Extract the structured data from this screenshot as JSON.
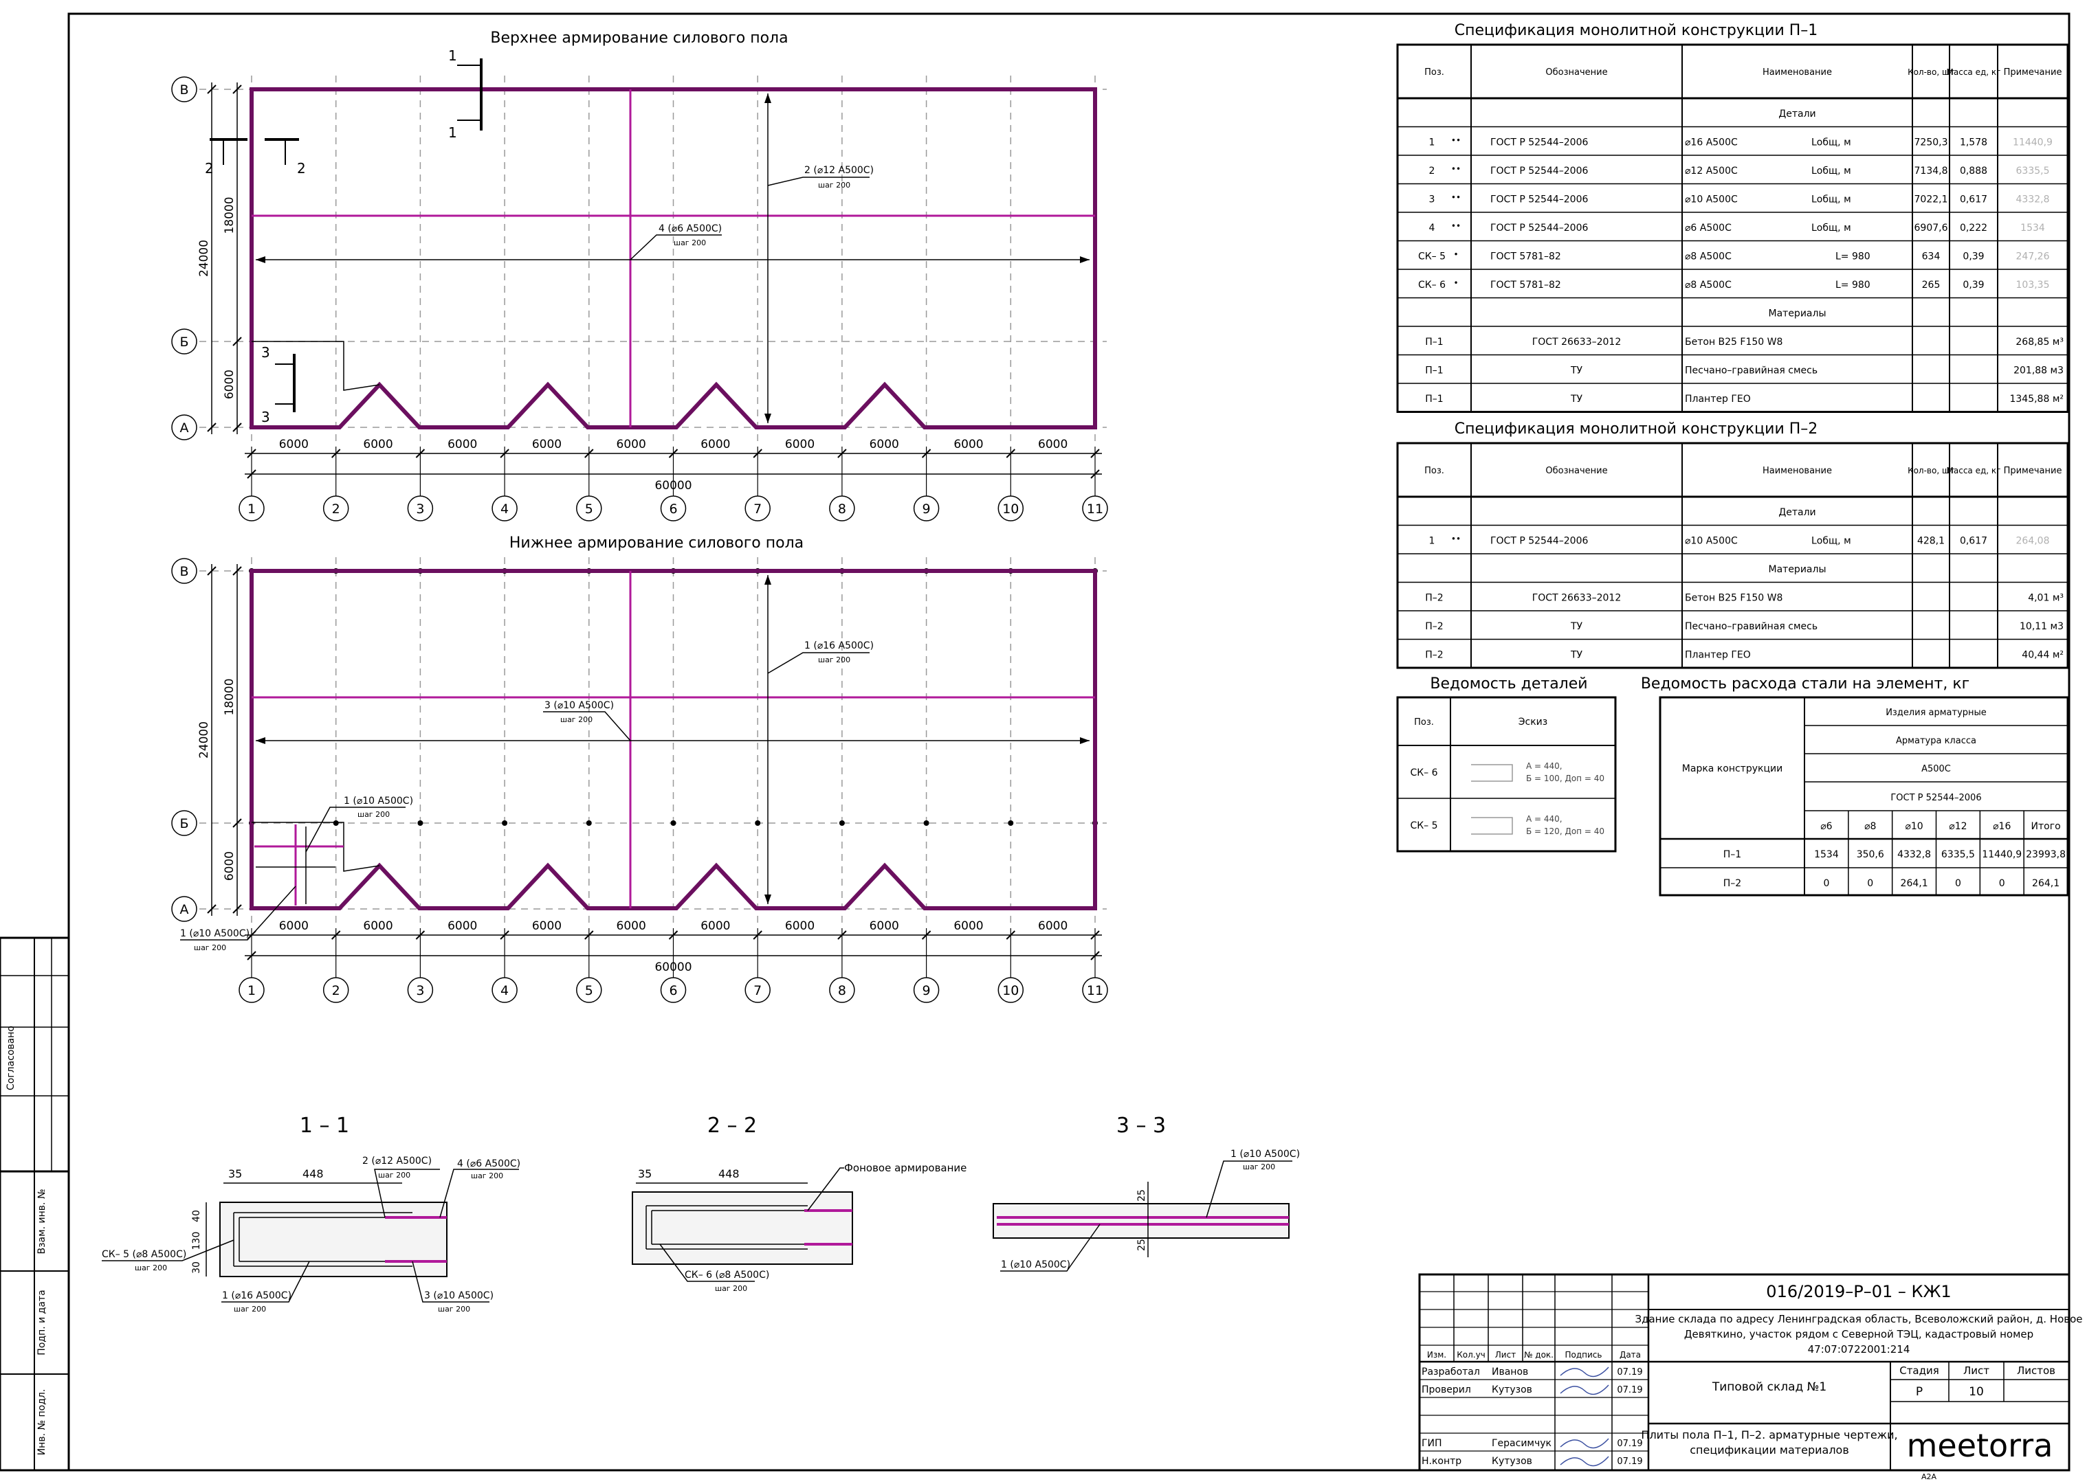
{
  "plan_top": {
    "title": "Верхнее армирование силового пола",
    "rows": [
      "В",
      "Б",
      "А"
    ],
    "cols": [
      "1",
      "2",
      "3",
      "4",
      "5",
      "6",
      "7",
      "8",
      "9",
      "10",
      "11"
    ],
    "spans": [
      "6000",
      "6000",
      "6000",
      "6000",
      "6000",
      "6000",
      "6000",
      "6000",
      "6000",
      "6000"
    ],
    "total": "60000",
    "dim_total_v": "24000",
    "dim_top_v": "18000",
    "dim_bottom_v": "6000",
    "callout_a": "2 (⌀12 А500С)",
    "callout_a_step": "шаг 200",
    "callout_b": "4 (⌀6 А500С)",
    "callout_b_step": "шаг 200",
    "cut_1": "1",
    "cut_2": "2",
    "cut_3": "3"
  },
  "plan_bottom": {
    "title": "Нижнее армирование силового пола",
    "rows": [
      "В",
      "Б",
      "А"
    ],
    "cols": [
      "1",
      "2",
      "3",
      "4",
      "5",
      "6",
      "7",
      "8",
      "9",
      "10",
      "11"
    ],
    "spans": [
      "6000",
      "6000",
      "6000",
      "6000",
      "6000",
      "6000",
      "6000",
      "6000",
      "6000",
      "6000"
    ],
    "total": "60000",
    "dim_total_v": "24000",
    "dim_top_v": "18000",
    "dim_bottom_v": "6000",
    "callout_a": "1 (⌀16 А500С)",
    "callout_a_step": "шаг 200",
    "callout_b": "3 (⌀10 А500С)",
    "callout_b_step": "шаг 200",
    "callout_c": "1 (⌀10 А500С)",
    "callout_c_step": "шаг 200",
    "callout_d": "1 (⌀10 А500С)",
    "callout_d_step": "шаг 200"
  },
  "sections": {
    "s1": {
      "title": "1 – 1",
      "dim_35": "35",
      "dim_448": "448",
      "dim_40": "40",
      "dim_130": "130",
      "dim_30": "30",
      "l1": "2 (⌀12 А500С)",
      "l1s": "шаг 200",
      "l2": "4 (⌀6 А500С)",
      "l2s": "шаг 200",
      "l3": "СК– 5 (⌀8 А500С)",
      "l3s": "шаг 200",
      "l4": "1 (⌀16 А500С)",
      "l4s": "шаг 200",
      "l5": "3 (⌀10 А500С)",
      "l5s": "шаг 200"
    },
    "s2": {
      "title": "2 – 2",
      "dim_35": "35",
      "dim_448": "448",
      "l1": "Фоновое армирование",
      "l2": "СК– 6 (⌀8 А500С)",
      "l2s": "шаг 200"
    },
    "s3": {
      "title": "3 – 3",
      "dim_25a": "25",
      "dim_25b": "25",
      "l1": "1 (⌀10 А500С)",
      "l1s": "шаг 200",
      "l2": "1 (⌀10 А500С)"
    }
  },
  "spec1": {
    "title": "Спецификация монолитной конструкции П–1",
    "headers": [
      "Поз.",
      "Обозначение",
      "Наименование",
      "Кол-во, шт",
      "Масса ед, кг",
      "Примечание"
    ],
    "group_details": "Детали",
    "group_materials": "Материалы",
    "details": [
      {
        "pos": "1",
        "mark": "••",
        "doc": "ГОСТ Р 52544–2006",
        "name": "⌀16 А500С",
        "extra": "Lобщ, м",
        "qty": "7250,3",
        "mass": "1,578",
        "note": "11440,9"
      },
      {
        "pos": "2",
        "mark": "••",
        "doc": "ГОСТ Р 52544–2006",
        "name": "⌀12 А500С",
        "extra": "Lобщ, м",
        "qty": "7134,8",
        "mass": "0,888",
        "note": "6335,5"
      },
      {
        "pos": "3",
        "mark": "••",
        "doc": "ГОСТ Р 52544–2006",
        "name": "⌀10 А500С",
        "extra": "Lобщ, м",
        "qty": "7022,1",
        "mass": "0,617",
        "note": "4332,8"
      },
      {
        "pos": "4",
        "mark": "••",
        "doc": "ГОСТ Р 52544–2006",
        "name": "⌀6 А500С",
        "extra": "Lобщ, м",
        "qty": "6907,6",
        "mass": "0,222",
        "note": "1534"
      },
      {
        "pos": "СК– 5",
        "mark": "•",
        "doc": "ГОСТ 5781–82",
        "name": "⌀8 А500С",
        "extra": "L= 980",
        "qty": "634",
        "mass": "0,39",
        "note": "247,26"
      },
      {
        "pos": "СК– 6",
        "mark": "•",
        "doc": "ГОСТ 5781–82",
        "name": "⌀8 А500С",
        "extra": "L= 980",
        "qty": "265",
        "mass": "0,39",
        "note": "103,35"
      }
    ],
    "materials": [
      {
        "pos": "П–1",
        "doc": "ГОСТ 26633–2012",
        "name": "Бетон B25 F150 W8",
        "note": "268,85 м³"
      },
      {
        "pos": "П–1",
        "doc": "ТУ",
        "name": "Песчано–гравийная смесь",
        "note": "201,88 м3"
      },
      {
        "pos": "П–1",
        "doc": "ТУ",
        "name": "Плантер ГЕО",
        "note": "1345,88 м²"
      }
    ]
  },
  "spec2": {
    "title": "Спецификация монолитной конструкции П–2",
    "headers": [
      "Поз.",
      "Обозначение",
      "Наименование",
      "Кол-во, шт",
      "Масса ед, кг",
      "Примечание"
    ],
    "group_details": "Детали",
    "group_materials": "Материалы",
    "details": [
      {
        "pos": "1",
        "mark": "••",
        "doc": "ГОСТ Р 52544–2006",
        "name": "⌀10 А500С",
        "extra": "Lобщ, м",
        "qty": "428,1",
        "mass": "0,617",
        "note": "264,08"
      }
    ],
    "materials": [
      {
        "pos": "П–2",
        "doc": "ГОСТ 26633–2012",
        "name": "Бетон B25 F150 W8",
        "note": "4,01 м³"
      },
      {
        "pos": "П–2",
        "doc": "ТУ",
        "name": "Песчано–гравийная смесь",
        "note": "10,11 м3"
      },
      {
        "pos": "П–2",
        "doc": "ТУ",
        "name": "Плантер ГЕО",
        "note": "40,44 м²"
      }
    ]
  },
  "parts": {
    "title": "Ведомость деталей",
    "headers": [
      "Поз.",
      "Эскиз"
    ],
    "rows": [
      {
        "pos": "СК– 6",
        "line1": "А = 440,",
        "line2": "Б = 100, Доп = 40"
      },
      {
        "pos": "СК– 5",
        "line1": "А = 440,",
        "line2": "Б = 120, Доп = 40"
      }
    ]
  },
  "steel": {
    "title": "Ведомость расхода стали на элемент, кг",
    "h_mark": "Марка конструкции",
    "h_items": "Изделия арматурные",
    "h_class": "Арматура класса",
    "h_a500": "А500С",
    "h_gost": "ГОСТ Р 52544–2006",
    "cols": [
      "⌀6",
      "⌀8",
      "⌀10",
      "⌀12",
      "⌀16",
      "Итого"
    ],
    "rows": [
      {
        "mark": "П–1",
        "vals": [
          "1534",
          "350,6",
          "4332,8",
          "6335,5",
          "11440,9",
          "23993,8"
        ]
      },
      {
        "mark": "П–2",
        "vals": [
          "0",
          "0",
          "264,1",
          "0",
          "0",
          "264,1"
        ]
      }
    ]
  },
  "side_stamp": {
    "agreed": "Согласовано",
    "inv_vzam": "Взам. инв. №",
    "sign_date": "Подп. и дата",
    "inv_orig": "Инв. № подл."
  },
  "title_block": {
    "code": "016/2019–Р–01 – КЖ1",
    "object_l1": "Здание склада по адресу Ленинградская область, Всеволожский район, д. Новое",
    "object_l2": "Девяткино, участок рядом с Северной ТЭЦ, кадастровый номер",
    "object_l3": "47:07:0722001:214",
    "h_izm": "Изм.",
    "h_kol": "Кол.уч",
    "h_list": "Лист",
    "h_doc": "№ док.",
    "h_sign": "Подпись",
    "h_date": "Дата",
    "people": [
      {
        "role": "Разработал",
        "name": "Иванов",
        "date": "07.19"
      },
      {
        "role": "Проверил",
        "name": "Кутузов",
        "date": "07.19"
      },
      {
        "role": "ГИП",
        "name": "Герасимчук",
        "date": "07.19"
      },
      {
        "role": "Н.контр",
        "name": "Кутузов",
        "date": "07.19"
      }
    ],
    "building": "Типовой склад №1",
    "h_stage": "Стадия",
    "h_sheet": "Лист",
    "h_sheets": "Листов",
    "stage": "Р",
    "sheet": "10",
    "sheets": "",
    "drawing_l1": "Плиты пола П–1, П–2. арматурные чертежи,",
    "drawing_l2": "спецификации материалов",
    "logo": "meetorra",
    "format": "А2А"
  }
}
